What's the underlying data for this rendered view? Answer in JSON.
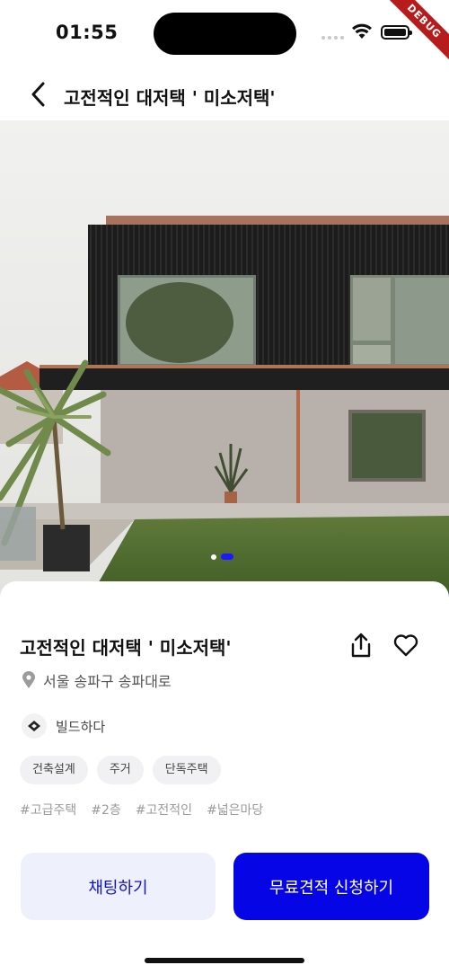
{
  "status_bar": {
    "time": "01:55",
    "debug_label": "DEBUG",
    "wifi_icon": "wifi-icon",
    "battery_icon": "battery-icon"
  },
  "header": {
    "back_icon": "chevron-left-icon",
    "title": "고전적인 대저택 ' 미소저택'"
  },
  "gallery": {
    "image_count": 2,
    "active_index": 1
  },
  "detail": {
    "title": "고전적인 대저택 ' 미소저택'",
    "share_icon": "share-icon",
    "like_icon": "heart-icon",
    "location_icon": "location-pin-icon",
    "location": "서울 송파구 송파대로",
    "company_name": "빌드하다",
    "tags": [
      "건축설계",
      "주거",
      "단독주택"
    ],
    "hashtags": [
      "#고급주택",
      "#2층",
      "#고전적인",
      "#넓은마당"
    ]
  },
  "actions": {
    "chat_label": "채팅하기",
    "quote_label": "무료견적 신청하기"
  },
  "colors": {
    "primary": "#0505e6",
    "chat_bg": "#eef1fb",
    "chat_text": "#1212cc",
    "debug": "#b71c1c"
  }
}
